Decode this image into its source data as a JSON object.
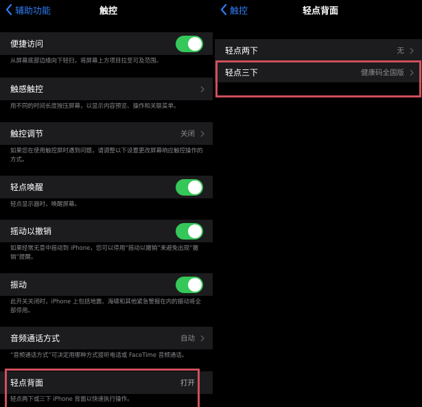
{
  "left": {
    "back_label": "辅助功能",
    "title": "触控",
    "items": [
      {
        "label": "便捷访问",
        "toggle_on": true,
        "footnote": "从屏幕底部边缘向下轻扫，将屏幕上方项目拉至可及范围。"
      },
      {
        "label": "触感触控",
        "footnote": "用不同的时间长度按压屏幕，以显示内容预览、操作和关联菜单。"
      },
      {
        "label": "触控调节",
        "value": "关闭",
        "footnote": "如果您在使用触控屏时遇到问题，请调整以下设置更改屏幕响应触控操作的方式。"
      },
      {
        "label": "轻点唤醒",
        "toggle_on": true,
        "footnote": "轻点显示器时，唤醒屏幕。"
      },
      {
        "label": "摇动以撤销",
        "toggle_on": true,
        "footnote": "如果经常无意中摇动到 iPhone，您可以停用“摇动以撤销”来避免出现“撤销”提醒。"
      },
      {
        "label": "振动",
        "toggle_on": true,
        "footnote": "此开关关闭时，iPhone 上包括地震、海啸和其他紧急警报在内的振动将全部停用。"
      },
      {
        "label": "音频通话方式",
        "value": "自动",
        "footnote": "“音频通话方式”可决定用哪种方式接听电话或 FaceTime 音频通话。"
      },
      {
        "label": "轻点背面",
        "value": "打开",
        "footnote": "轻点两下或三下 iPhone 背面以快速执行操作。"
      }
    ]
  },
  "right": {
    "back_label": "触控",
    "title": "轻点背面",
    "items": [
      {
        "label": "轻点两下",
        "value": "无"
      },
      {
        "label": "轻点三下",
        "value": "健康码全国版"
      }
    ]
  },
  "colors": {
    "accent": "#2f7cf6",
    "toggle_on": "#35c759",
    "highlight": "#d0505d",
    "cell_bg": "#1c1c1e",
    "secondary_text": "#8a8a8f"
  }
}
